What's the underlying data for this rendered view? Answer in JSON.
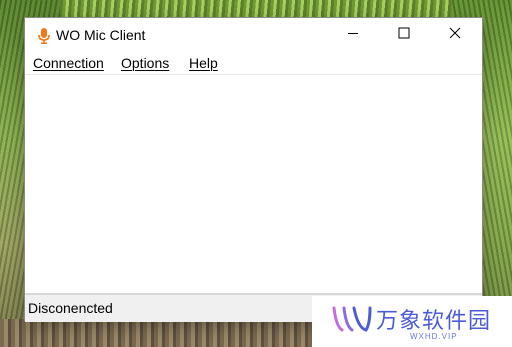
{
  "window": {
    "title": "WO Mic Client"
  },
  "menu": {
    "items": [
      {
        "label": "Connection"
      },
      {
        "label": "Options"
      },
      {
        "label": "Help"
      }
    ]
  },
  "status": {
    "text": "Disconencted"
  },
  "watermark": {
    "text": "万象软件园",
    "sub": "WXHD.VIP"
  },
  "icons": {
    "app": "microphone-icon",
    "minimize": "minimize-icon",
    "maximize": "maximize-icon",
    "close": "close-icon"
  },
  "colors": {
    "app_icon": "#f07a1a",
    "watermark": "#4b5cd6"
  }
}
